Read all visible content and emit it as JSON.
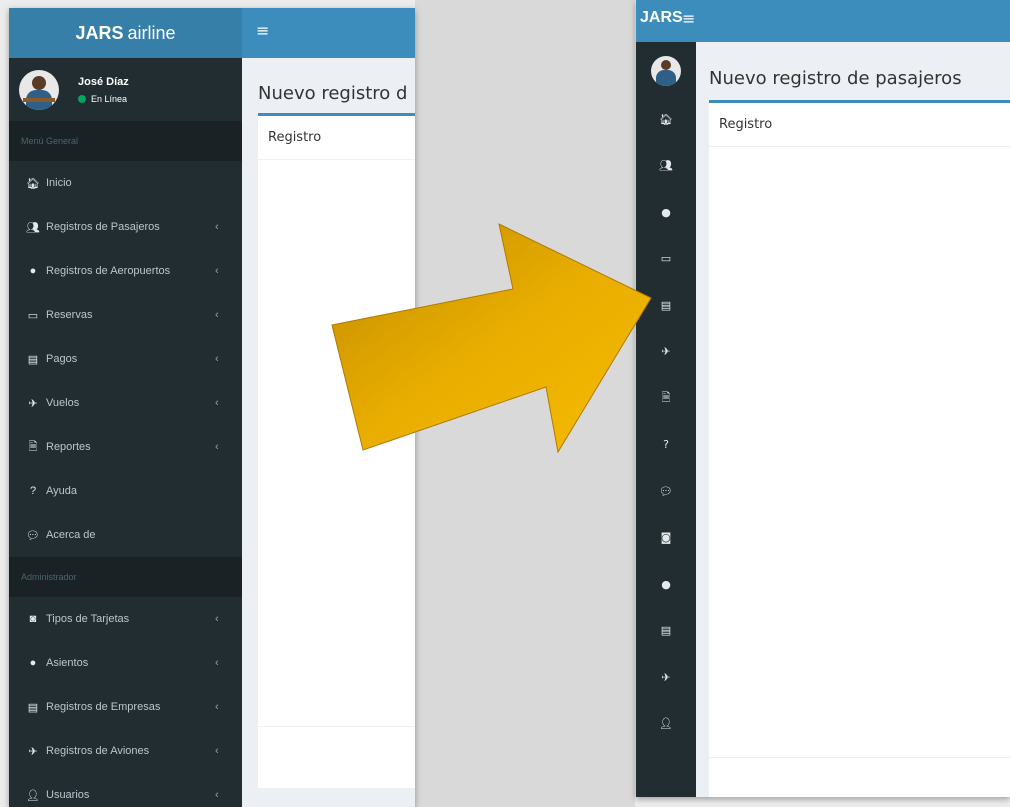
{
  "colors": {
    "navbar": "#3c8dbc",
    "logo": "#367fa9",
    "sidebar": "#222d32",
    "online": "#00a65a",
    "arrow": "#e0a800"
  },
  "left": {
    "logo_bold": "JARS",
    "logo_rest": "airline",
    "menu_icon": "≡",
    "user": {
      "name": "José Díaz",
      "status": "En Línea"
    },
    "header_general": "Menú General",
    "items_general": [
      {
        "icon": "home-icon",
        "glyph": "🏠︎",
        "label": "Inicio",
        "chevron": ""
      },
      {
        "icon": "user-plus-icon",
        "glyph": "👥︎",
        "label": "Registros de Pasajeros",
        "chevron": "‹"
      },
      {
        "icon": "globe-icon",
        "glyph": "●",
        "label": "Registros de Aeropuertos",
        "chevron": "‹"
      },
      {
        "icon": "visa-card-icon",
        "glyph": "▭",
        "label": "Reservas",
        "chevron": "‹"
      },
      {
        "icon": "credit-card-icon",
        "glyph": "▤",
        "label": "Pagos",
        "chevron": "‹"
      },
      {
        "icon": "plane-icon",
        "glyph": "✈",
        "label": "Vuelos",
        "chevron": "‹"
      },
      {
        "icon": "pdf-file-icon",
        "glyph": "🗎︎",
        "label": "Reportes",
        "chevron": "‹"
      },
      {
        "icon": "question-circle-icon",
        "glyph": "?",
        "label": "Ayuda",
        "chevron": ""
      },
      {
        "icon": "comment-icon",
        "glyph": "💬︎",
        "label": "Acerca de",
        "chevron": ""
      }
    ],
    "header_admin": "Administrador",
    "items_admin": [
      {
        "icon": "mastercard-icon",
        "glyph": "◙",
        "label": "Tipos de Tarjetas",
        "chevron": "‹"
      },
      {
        "icon": "globe-icon",
        "glyph": "●",
        "label": "Asientos",
        "chevron": "‹"
      },
      {
        "icon": "file-text-icon",
        "glyph": "▤",
        "label": "Registros de Empresas",
        "chevron": "‹"
      },
      {
        "icon": "plane-icon",
        "glyph": "✈",
        "label": "Registros de Aviones",
        "chevron": "‹"
      },
      {
        "icon": "user-icon",
        "glyph": "👤︎",
        "label": "Usuarios",
        "chevron": "‹"
      }
    ],
    "page_title": "Nuevo registro d",
    "box_title": "Registro"
  },
  "right": {
    "logo": "JARS",
    "menu_icon": "≡",
    "items": [
      {
        "icon": "home-icon",
        "glyph": "🏠︎"
      },
      {
        "icon": "user-plus-icon",
        "glyph": "👥︎"
      },
      {
        "icon": "globe-icon",
        "glyph": "●"
      },
      {
        "icon": "visa-card-icon",
        "glyph": "▭"
      },
      {
        "icon": "credit-card-icon",
        "glyph": "▤"
      },
      {
        "icon": "plane-icon",
        "glyph": "✈"
      },
      {
        "icon": "pdf-file-icon",
        "glyph": "🗎︎"
      },
      {
        "icon": "question-circle-icon",
        "glyph": "?"
      },
      {
        "icon": "comment-icon",
        "glyph": "💬︎"
      },
      {
        "icon": "mastercard-icon",
        "glyph": "◙"
      },
      {
        "icon": "globe-icon",
        "glyph": "●"
      },
      {
        "icon": "file-text-icon",
        "glyph": "▤"
      },
      {
        "icon": "plane-icon",
        "glyph": "✈"
      },
      {
        "icon": "user-icon",
        "glyph": "👤︎"
      }
    ],
    "page_title": "Nuevo registro de pasajeros",
    "box_title": "Registro"
  }
}
